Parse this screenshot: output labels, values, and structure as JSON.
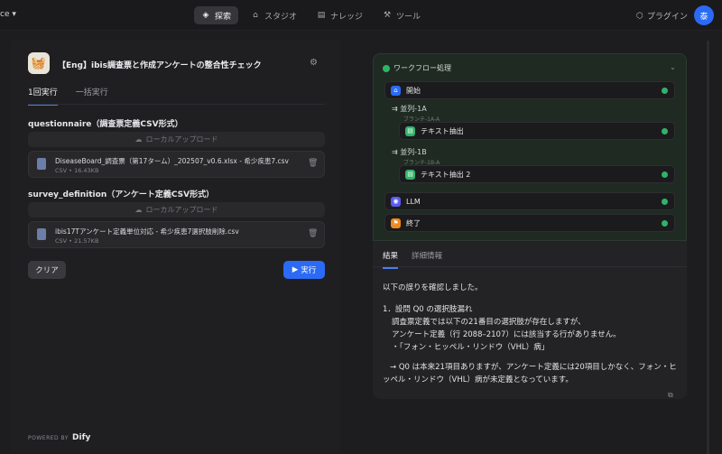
{
  "topbar": {
    "workspace": "ce",
    "nav": [
      {
        "label": "探索",
        "icon": "compass-icon",
        "active": true
      },
      {
        "label": "スタジオ",
        "icon": "studio-icon",
        "active": false
      },
      {
        "label": "ナレッジ",
        "icon": "book-icon",
        "active": false
      },
      {
        "label": "ツール",
        "icon": "wrench-icon",
        "active": false
      }
    ],
    "plugin_label": "プラグイン",
    "avatar_initial": "泰"
  },
  "app": {
    "title": "【Eng】ibis調査票と作成アンケートの整合性チェック",
    "tabs": [
      "1回実行",
      "一括実行"
    ],
    "fields": [
      {
        "label": "questionnaire（調査票定義CSV形式）",
        "upload_label": "ローカルアップロード",
        "file_name": "DiseaseBoard_調査票（第17ターム）_202507_v0.6.xlsx - 希少疾患7.csv",
        "file_meta": "CSV • 16.43KB"
      },
      {
        "label": "survey_definition（アンケート定義CSV形式）",
        "upload_label": "ローカルアップロード",
        "file_name": "ibis17Tアンケート定義単位対応 - 希少疾患7選択肢削除.csv",
        "file_meta": "CSV • 21.57KB"
      }
    ],
    "clear_label": "クリア",
    "run_label": "実行",
    "powered_by": "POWERED BY",
    "brand": "Dify"
  },
  "workflow": {
    "title": "ワークフロー処理",
    "start": "開始",
    "branch1_title": "並列-1A",
    "branch1_sub": "ブランチ-1A-A",
    "extract1": "テキスト抽出",
    "branch2_title": "並列-1B",
    "branch2_sub": "ブランチ-1B-A",
    "extract2": "テキスト抽出 2",
    "llm": "LLM",
    "end": "終了",
    "colors": {
      "success": "#2fb36a",
      "accent": "#2b6af5"
    }
  },
  "result": {
    "tabs": [
      "結果",
      "詳細情報"
    ],
    "line1": "以下の誤りを確認しました。",
    "line2": "1．設問 Q0 の選択肢漏れ",
    "line3": "調査票定義では以下の21番目の選択肢が存在しますが、",
    "line4": "アンケート定義（行 2088–2107）には該当する行がありません。",
    "line5": "・「フォン・ヒッペル・リンドウ（VHL）病」",
    "line6": "→ Q0 は本来21項目ありますが、アンケート定義には20項目しかなく、フォン・ヒッペル・リンドウ（VHL）病が未定義となっています。"
  }
}
